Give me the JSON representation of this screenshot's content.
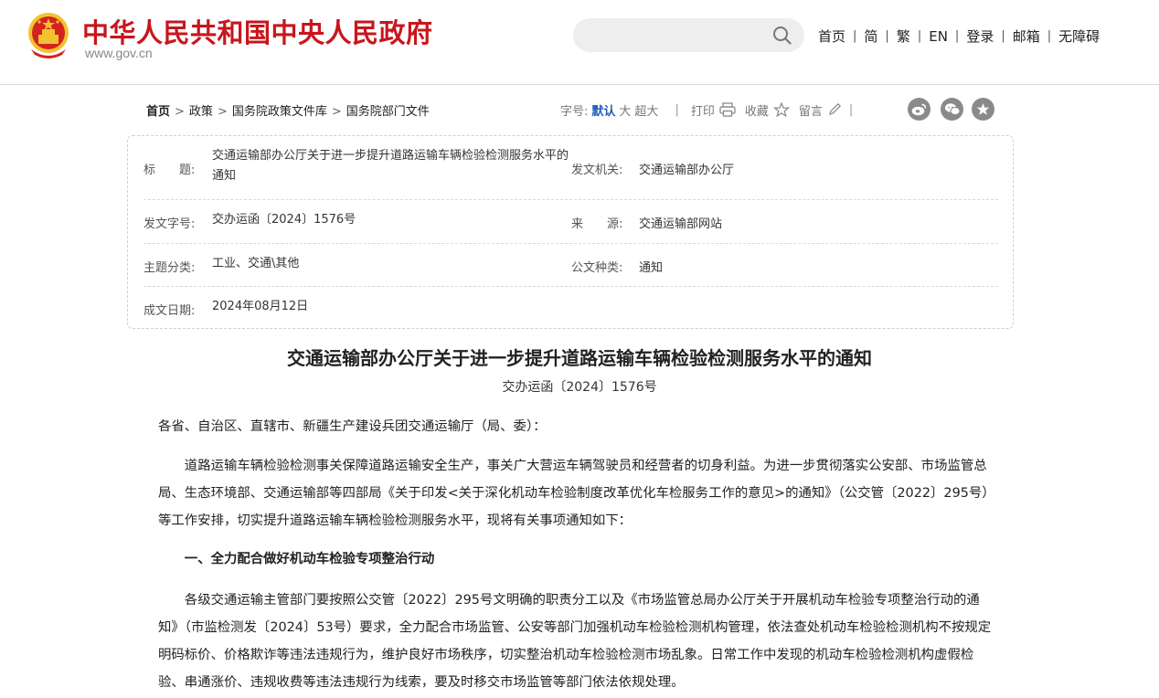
{
  "header": {
    "site_title": "中华人民共和国中央人民政府",
    "site_url": "www.gov.cn",
    "search": {
      "placeholder": ""
    },
    "nav": [
      {
        "label": "首页"
      },
      {
        "label": "简"
      },
      {
        "label": "繁"
      },
      {
        "label": "EN"
      },
      {
        "label": "登录"
      },
      {
        "label": "邮箱"
      },
      {
        "label": "无障碍"
      }
    ],
    "nav_separator": "|"
  },
  "breadcrumb": {
    "items": [
      "首页",
      "政策",
      "国务院政策文件库",
      "国务院部门文件"
    ],
    "separator": ">"
  },
  "toolbar": {
    "font_size_label": "字号:",
    "font_sizes": [
      "默认",
      "大",
      "超大"
    ],
    "divider": "|",
    "print_label": "打印",
    "favorite_label": "收藏",
    "comment_label": "留言"
  },
  "meta": {
    "title_label": "标　　题:",
    "title_value": "交通运输部办公厅关于进一步提升道路运输车辆检验检测服务水平的通知",
    "issuer_label": "发文机关:",
    "issuer_value": "交通运输部办公厅",
    "docno_label": "发文字号:",
    "docno_value": "交办运函〔2024〕1576号",
    "source_label": "来　　源:",
    "source_value": "交通运输部网站",
    "topic_label": "主题分类:",
    "topic_value": "工业、交通\\其他",
    "type_label": "公文种类:",
    "type_value": "通知",
    "date_label": "成文日期:",
    "date_value": "2024年08月12日"
  },
  "article": {
    "title": "交通运输部办公厅关于进一步提升道路运输车辆检验检测服务水平的通知",
    "doc_number": "交办运函〔2024〕1576号",
    "salutation": "各省、自治区、直辖市、新疆生产建设兵团交通运输厅（局、委）：",
    "paragraph1": "道路运输车辆检验检测事关保障道路运输安全生产，事关广大营运车辆驾驶员和经营者的切身利益。为进一步贯彻落实公安部、市场监管总局、生态环境部、交通运输部等四部局《关于印发<关于深化机动车检验制度改革优化车检服务工作的意见>的通知》（公交管〔2022〕295号）等工作安排，切实提升道路运输车辆检验检测服务水平，现将有关事项通知如下：",
    "heading1": "一、全力配合做好机动车检验专项整治行动",
    "paragraph2": "各级交通运输主管部门要按照公交管〔2022〕295号文明确的职责分工以及《市场监管总局办公厅关于开展机动车检验专项整治行动的通知》（市监检测发〔2024〕53号）要求，全力配合市场监管、公安等部门加强机动车检验检测机构管理，依法查处机动车检验检测机构不按规定明码标价、价格欺诈等违法违规行为，维护良好市场秩序，切实整治机动车检验检测市场乱象。日常工作中发现的机动车检验检测机构虚假检验、串通涨价、违规收费等违法违规行为线索，要及时移交市场监管等部门依法依规处理。"
  },
  "colors": {
    "brand_red": "#c8161d",
    "link_blue": "#1f5bb8",
    "emblem_gold": "#f2c230"
  },
  "icons": [
    "national-emblem-icon",
    "search-icon",
    "print-icon",
    "star-icon",
    "pencil-icon",
    "weibo-icon",
    "wechat-icon",
    "favorite-share-icon"
  ]
}
